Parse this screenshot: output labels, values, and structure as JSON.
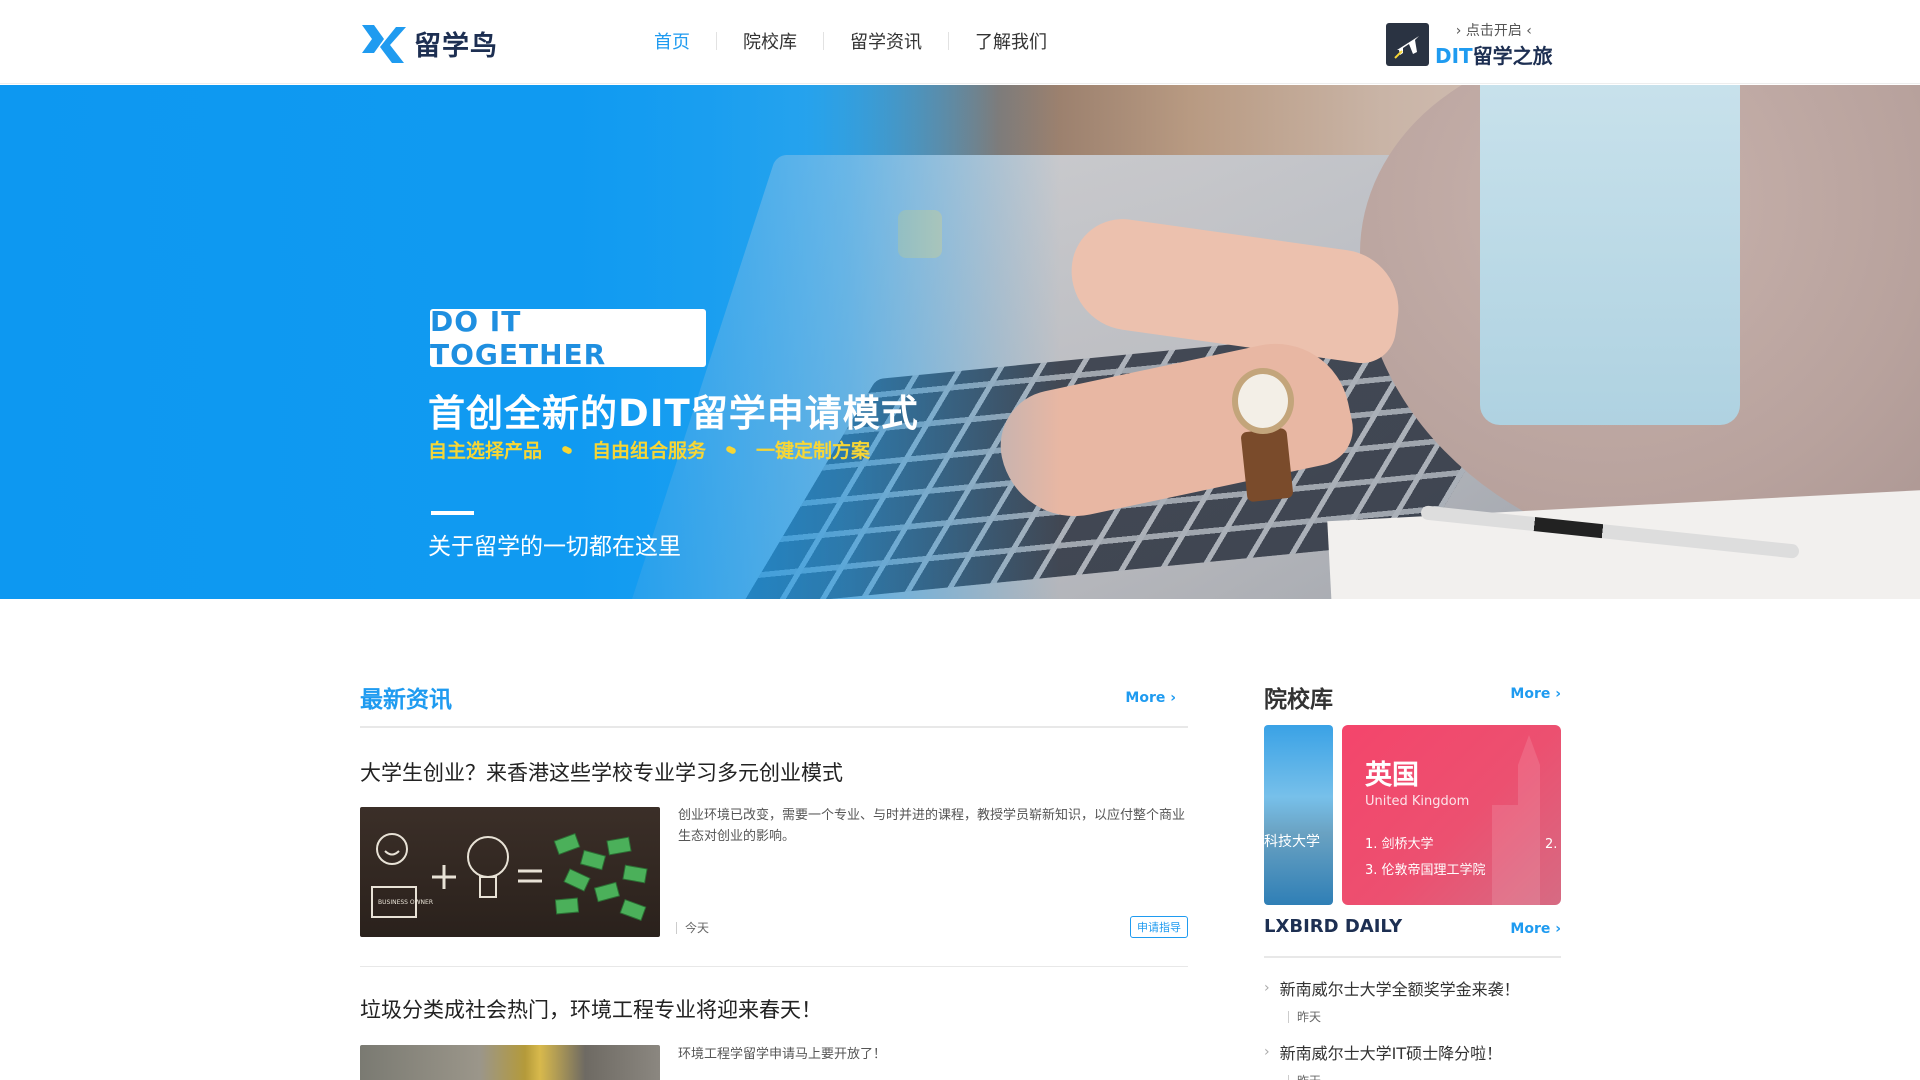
{
  "brand": {
    "name": "留学鸟",
    "accent": "#1f9bf0",
    "dark": "#1d2f52"
  },
  "nav": {
    "items": [
      "首页",
      "院校库",
      "留学资讯",
      "了解我们"
    ],
    "active": "首页"
  },
  "trip": {
    "small": "点击开启",
    "dit": "DIT",
    "rest": "留学之旅",
    "icon": "plane-icon"
  },
  "banner": {
    "badge": "DO IT TOGETHER",
    "title": "首创全新的DIT留学申请模式",
    "tags": [
      "自主选择产品",
      "自由组合服务",
      "一键定制方案"
    ],
    "subtitle": "关于留学的一切都在这里",
    "tag_color": "#f7d635"
  },
  "news": {
    "title": "最新资讯",
    "more": "More",
    "articles": [
      {
        "title": "大学生创业？来香港这些学校专业学习多元创业模式",
        "summary": "创业环境已改变，需要一个专业、与时并进的课程，教授学员崭新知识，以应付整个商业生态对创业的影响。",
        "date": "今天",
        "tag": "申请指导",
        "thumb_caption": "BUSINESS OWNER"
      },
      {
        "title": "垃圾分类成社会热门，环境工程专业将迎来春天！",
        "summary": "环境工程学留学申请马上要开放了！"
      }
    ]
  },
  "schools": {
    "title": "院校库",
    "more": "More",
    "strip_text": "科技大学",
    "card": {
      "title": "英国",
      "subtitle": "United Kingdom",
      "items": [
        "1. 剑桥大学",
        "3. 伦敦帝国理工学院"
      ],
      "partial": "2."
    }
  },
  "daily": {
    "title": "LXBIRD DAILY",
    "more": "More",
    "items": [
      {
        "title": "新南威尔士大学全额奖学金来袭！",
        "date": "昨天"
      },
      {
        "title": "新南威尔士大学IT硕士降分啦！",
        "date": "昨天"
      }
    ]
  }
}
